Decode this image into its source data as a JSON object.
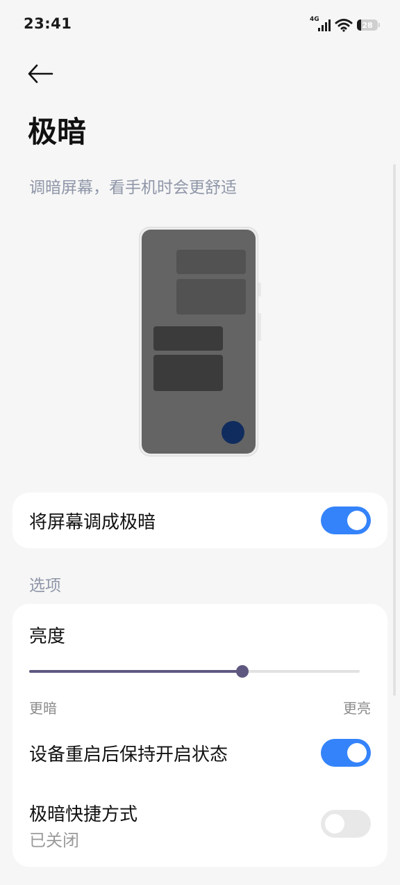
{
  "status_bar": {
    "time": "23:41",
    "network_label": "4G",
    "battery_level": "28",
    "icons": [
      "signal-icon",
      "wifi-icon",
      "battery-icon"
    ]
  },
  "header": {
    "back_icon": "arrow-left-icon",
    "title": "极暗",
    "subtitle": "调暗屏幕，看手机时会更舒适"
  },
  "main_toggle": {
    "label": "将屏幕调成极暗",
    "enabled": true
  },
  "options": {
    "section_title": "选项",
    "brightness": {
      "label": "亮度",
      "value_fraction": 0.645,
      "min_label": "更暗",
      "max_label": "更亮"
    },
    "keep_after_restart": {
      "label": "设备重启后保持开启状态",
      "enabled": true
    },
    "shortcut": {
      "label": "极暗快捷方式",
      "status": "已关闭",
      "enabled": false
    }
  },
  "colors": {
    "accent": "#3483fa",
    "slider": "#5e5880",
    "secondary_text": "#8f96a8",
    "background": "#f6f6f6"
  }
}
